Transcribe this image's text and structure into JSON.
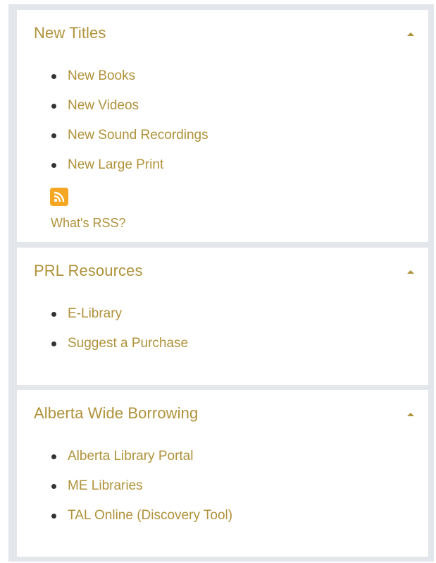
{
  "colors": {
    "link": "#b0923a",
    "frame_background": "#e3e6ea",
    "panel_background": "#ffffff",
    "rss_orange": "#f5a623"
  },
  "panels": [
    {
      "title": "New Titles",
      "toggle_icon": "caret-up-icon",
      "links": [
        "New Books",
        "New Videos",
        "New Sound Recordings",
        "New Large Print"
      ],
      "rss_icon": "rss-feed-icon",
      "rss_help_link": "What's RSS?"
    },
    {
      "title": "PRL Resources",
      "toggle_icon": "caret-up-icon",
      "links": [
        "E-Library",
        "Suggest a Purchase"
      ]
    },
    {
      "title": "Alberta Wide Borrowing",
      "toggle_icon": "caret-up-icon",
      "links": [
        "Alberta Library Portal",
        "ME Libraries",
        "TAL Online (Discovery Tool)"
      ]
    }
  ]
}
